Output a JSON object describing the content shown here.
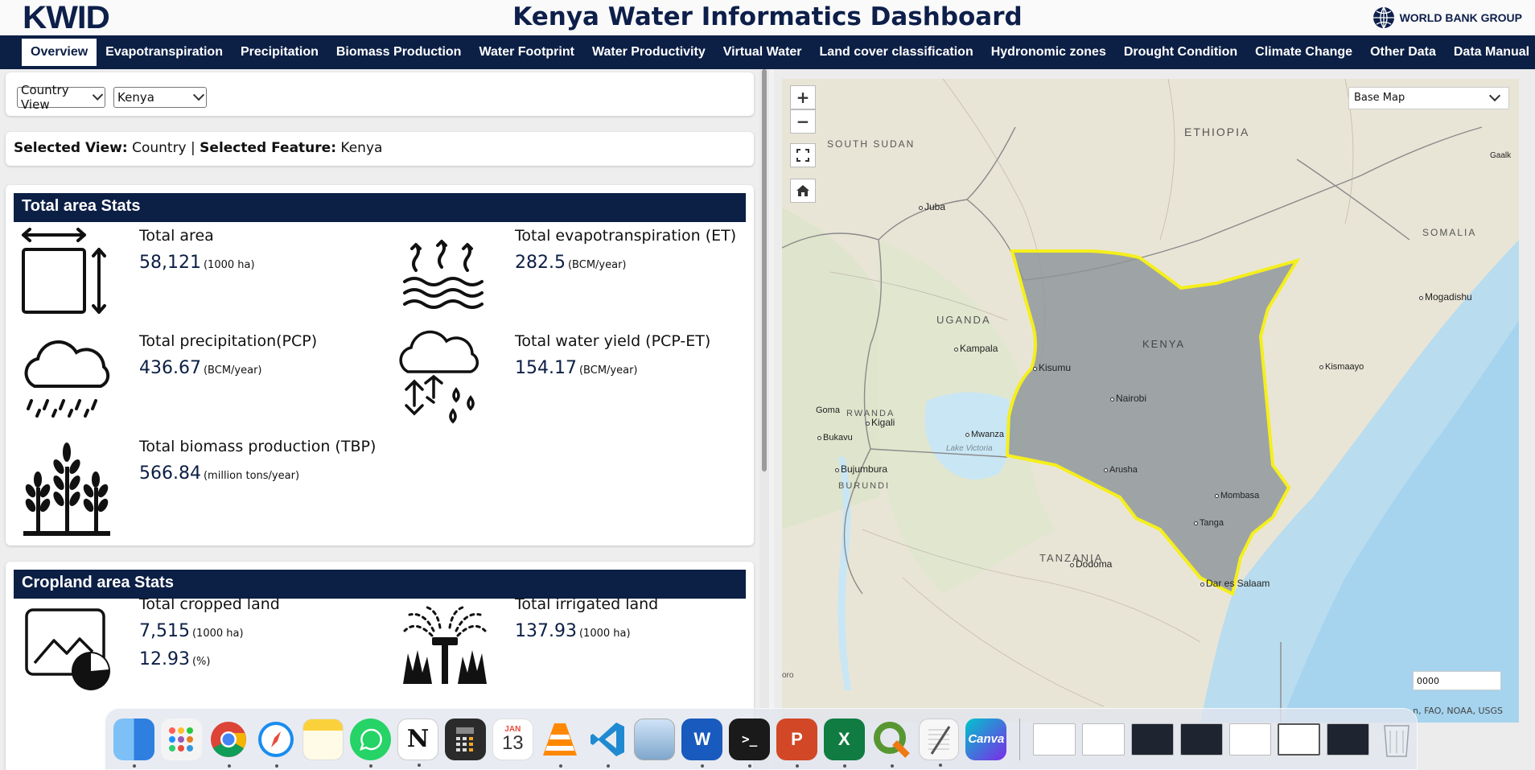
{
  "header": {
    "logo": "KWID",
    "title": "Kenya Water Informatics Dashboard",
    "partner": "WORLD BANK GROUP"
  },
  "nav": {
    "tabs": [
      {
        "label": "Overview",
        "active": true
      },
      {
        "label": "Evapotranspiration"
      },
      {
        "label": "Precipitation"
      },
      {
        "label": "Biomass Production"
      },
      {
        "label": "Water Footprint"
      },
      {
        "label": "Water Productivity"
      },
      {
        "label": "Virtual Water"
      },
      {
        "label": "Land cover classification"
      },
      {
        "label": "Hydronomic zones"
      },
      {
        "label": "Drought Condition"
      },
      {
        "label": "Climate Change"
      },
      {
        "label": "Other Data"
      },
      {
        "label": "Data Manual"
      }
    ]
  },
  "filters": {
    "view_select": "Country View",
    "feature_select": "Kenya"
  },
  "selection": {
    "view_label": "Selected View:",
    "view_value": "Country",
    "separator": "|",
    "feature_label": "Selected Feature:",
    "feature_value": "Kenya"
  },
  "total_area": {
    "heading": "Total area Stats",
    "stats": [
      {
        "label": "Total area",
        "value": "58,121",
        "unit": "(1000 ha)",
        "icon": "area-icon"
      },
      {
        "label": "Total evapotranspiration (ET)",
        "value": "282.5",
        "unit": "(BCM/year)",
        "icon": "evapotranspiration-icon"
      },
      {
        "label": "Total precipitation(PCP)",
        "value": "436.67",
        "unit": "(BCM/year)",
        "icon": "rain-cloud-icon"
      },
      {
        "label": "Total water yield (PCP-ET)",
        "value": "154.17",
        "unit": "(BCM/year)",
        "icon": "water-yield-icon"
      },
      {
        "label": "Total biomass production (TBP)",
        "value": "566.84",
        "unit": "(million tons/year)",
        "icon": "crops-icon"
      }
    ]
  },
  "cropland": {
    "heading": "Cropland area Stats",
    "stats": [
      {
        "label": "Total cropped land",
        "value": "7,515",
        "unit": "(1000 ha)",
        "value2": "12.93",
        "unit2": "(%)",
        "icon": "cropland-chart-icon"
      },
      {
        "label": "Total irrigated land",
        "value": "137.93",
        "unit": "(1000 ha)",
        "icon": "sprinkler-icon"
      }
    ]
  },
  "map": {
    "basemap_label": "Base Map",
    "zoom_in": "+",
    "zoom_out": "−",
    "countries": [
      "ETHIOPIA",
      "SOUTH SUDAN",
      "SOMALIA",
      "UGANDA",
      "KENYA",
      "RWANDA",
      "BURUNDI",
      "TANZANIA"
    ],
    "cities": [
      "Juba",
      "Mogadishu",
      "Kampala",
      "Kisumu",
      "Nairobi",
      "Kismaayo",
      "Goma",
      "Kigali",
      "Bukavu",
      "Mwanza",
      "Bujumbura",
      "Arusha",
      "Mombasa",
      "Tanga",
      "Dodoma",
      "Dar es Salaam",
      "Gaalk"
    ],
    "lake": "Lake Victoria",
    "scale_text": "0000",
    "attribution": "n, FAO, NOAA, USGS",
    "edge_text": "oro",
    "boundary_color": "#f5ef1c"
  },
  "dock": {
    "calendar_month": "JAN",
    "calendar_day": "13",
    "apps": [
      "finder",
      "launchpad",
      "chrome",
      "safari",
      "notes",
      "whatsapp",
      "notion",
      "calculator",
      "calendar",
      "vlc",
      "vscode",
      "preview",
      "word",
      "terminal",
      "powerpoint",
      "excel",
      "qgis",
      "textedit",
      "canva"
    ],
    "canva_label": "Canva"
  }
}
